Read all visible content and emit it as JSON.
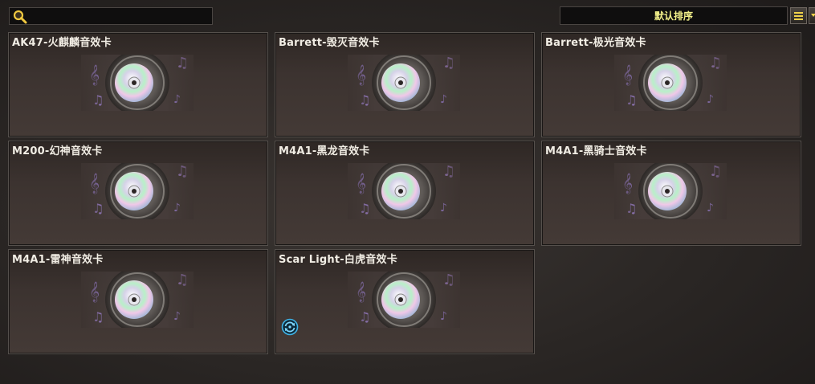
{
  "search": {
    "placeholder": "",
    "value": ""
  },
  "sort": {
    "label": "默认排序"
  },
  "icons": {
    "search": "magnifier-icon",
    "list": "list-icon",
    "scroll": "chevron-down-icon",
    "card_art": "sound-card-icon",
    "badge": "refresh-icon"
  },
  "colors": {
    "sort_text": "#f3f08a",
    "accent": "#f0d24a",
    "badge": "#3fb4e8"
  },
  "cards": [
    {
      "title": "AK47-火麒麟音效卡"
    },
    {
      "title": "Barrett-毁灭音效卡"
    },
    {
      "title": "Barrett-极光音效卡"
    },
    {
      "title": "M200-幻神音效卡"
    },
    {
      "title": "M4A1-黑龙音效卡"
    },
    {
      "title": "M4A1-黑骑士音效卡"
    },
    {
      "title": "M4A1-雷神音效卡"
    },
    {
      "title": "Scar Light-白虎音效卡",
      "badge": true
    }
  ]
}
